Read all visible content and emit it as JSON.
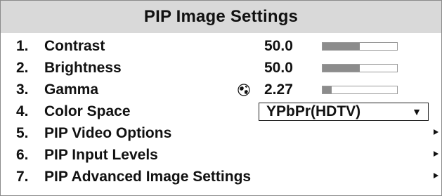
{
  "menu": {
    "title": "PIP Image Settings",
    "items": [
      {
        "number": "1.",
        "label": "Contrast",
        "value": "50.0",
        "level": 0.5
      },
      {
        "number": "2.",
        "label": "Brightness",
        "value": "50.0",
        "level": 0.5
      },
      {
        "number": "3.",
        "label": "Gamma",
        "value": "2.27",
        "level": 0.12,
        "icon": "globe-icon"
      },
      {
        "number": "4.",
        "label": "Color Space",
        "selected_option": "YPbPr(HDTV)",
        "dropdown_icon": "triangle-down-icon"
      },
      {
        "number": "5.",
        "label": "PIP Video Options",
        "icon": "submenu-arrow-icon"
      },
      {
        "number": "6.",
        "label": "PIP Input Levels",
        "icon": "submenu-arrow-icon"
      },
      {
        "number": "7.",
        "label": "PIP Advanced Image Settings",
        "icon": "submenu-arrow-icon"
      }
    ]
  },
  "colors": {
    "title_bar_bg": "#d9d9d9",
    "bar_fill": "#8c8c8c",
    "text": "#111111"
  }
}
